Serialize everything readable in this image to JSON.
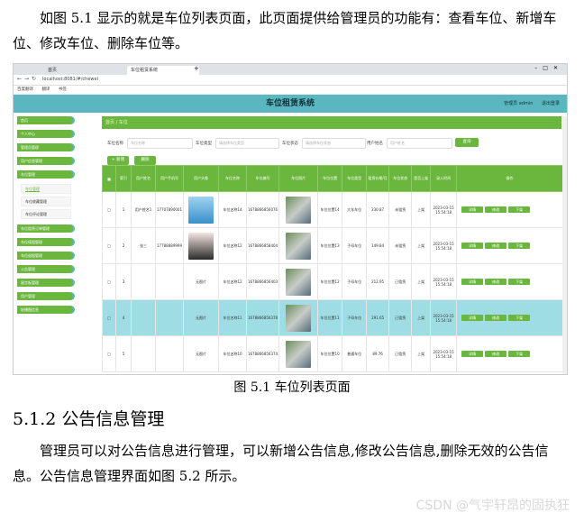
{
  "doc": {
    "para1": "如图 5.1 显示的就是车位列表页面，此页面提供给管理员的功能有：查看车位、新增车位、修改车位、删除车位等。",
    "caption": "图 5.1  车位列表页面",
    "heading": "5.1.2  公告信息管理",
    "para2": "管理员可以对公告信息进行管理，可以新增公告信息,修改公告信息,删除无效的公告信息。公告信息管理界面如图 5.2 所示。",
    "watermark": "CSDN @气宇轩昂的固执狂"
  },
  "browser": {
    "tab1": "首页",
    "tab2": "车位租赁系统",
    "url": "localhost:8081/#/chewei",
    "bookmarks": [
      "百度翻译",
      "翻译",
      "书签"
    ]
  },
  "app": {
    "title": "车位租赁系统",
    "user": "管理员 admin",
    "logout": "退出登录"
  },
  "sidebar": {
    "before": [
      "首页",
      "个人中心",
      "管理员管理",
      "用户信息管理",
      "车位管理"
    ],
    "subs": [
      "车位管理",
      "车位收藏管理",
      "车位评论管理"
    ],
    "after": [
      "车位租赁订单管理",
      "车位续租管理",
      "车位退租管理",
      "公告管理",
      "留言板管理",
      "用户管理",
      "轮播图信息"
    ]
  },
  "main": {
    "breadcrumb": "首页  /  车位",
    "search": {
      "l1": "车位名称",
      "p1": "车位名称",
      "l2": "车位类型",
      "p2": "请选择车位类型",
      "l3": "车位状态",
      "p3": "请选择车位状态",
      "l4": "用户姓名",
      "p4": "用户姓名",
      "btn": "查询"
    },
    "add": "+ 新增",
    "del": "删除"
  },
  "table": {
    "headers": [
      "",
      "索引",
      "用户姓名",
      "用户手机号",
      "用户头像",
      "车位名称",
      "车位编号",
      "车位照片",
      "车位位置",
      "车位类型",
      "租赁价格/月",
      "车位状态",
      "是否上架",
      "录入时间",
      "操作"
    ],
    "rows": [
      {
        "idx": "1",
        "name": "用户姓名1",
        "phone": "17707890001",
        "avatar": "",
        "cname": "车位名称14",
        "cno": "1678866856076",
        "loc": "车位位置14",
        "type": "大车车位",
        "price": "230.87",
        "status": "未租赁",
        "up": "上架",
        "time": "2023-03-15 15:54:18",
        "hl": false
      },
      {
        "idx": "2",
        "name": "张三",
        "phone": "17788889999",
        "avatar": "",
        "cname": "车位名称12",
        "cno": "1678866858404",
        "loc": "车位位置13",
        "type": "子母车位",
        "price": "149.84",
        "status": "未租赁",
        "up": "上架",
        "time": "2023-03-15 15:54:18",
        "hl": false
      },
      {
        "idx": "3",
        "name": "",
        "phone": "",
        "avatar": "无图片",
        "cname": "车位名称12",
        "cno": "1678866856403",
        "loc": "车位位置12",
        "type": "子母车位",
        "price": "212.95",
        "status": "已租赁",
        "up": "上架",
        "time": "2023-03-15 15:54:18",
        "hl": false
      },
      {
        "idx": "4",
        "name": "",
        "phone": "",
        "avatar": "无图片",
        "cname": "车位名称11",
        "cno": "1678866856378",
        "loc": "车位位置11",
        "type": "子母车位",
        "price": "291.65",
        "status": "已租赁",
        "up": "上架",
        "time": "2023-03-15 15:54:18",
        "hl": true
      },
      {
        "idx": "5",
        "name": "",
        "phone": "",
        "avatar": "无图片",
        "cname": "车位名称10",
        "cno": "1678866856374",
        "loc": "车位位置10",
        "type": "普通车位",
        "price": "89.76",
        "status": "已租赁",
        "up": "上架",
        "time": "2023-03-15 15:54:18",
        "hl": false
      }
    ],
    "actions": [
      "详情",
      "修改",
      "下架"
    ]
  }
}
